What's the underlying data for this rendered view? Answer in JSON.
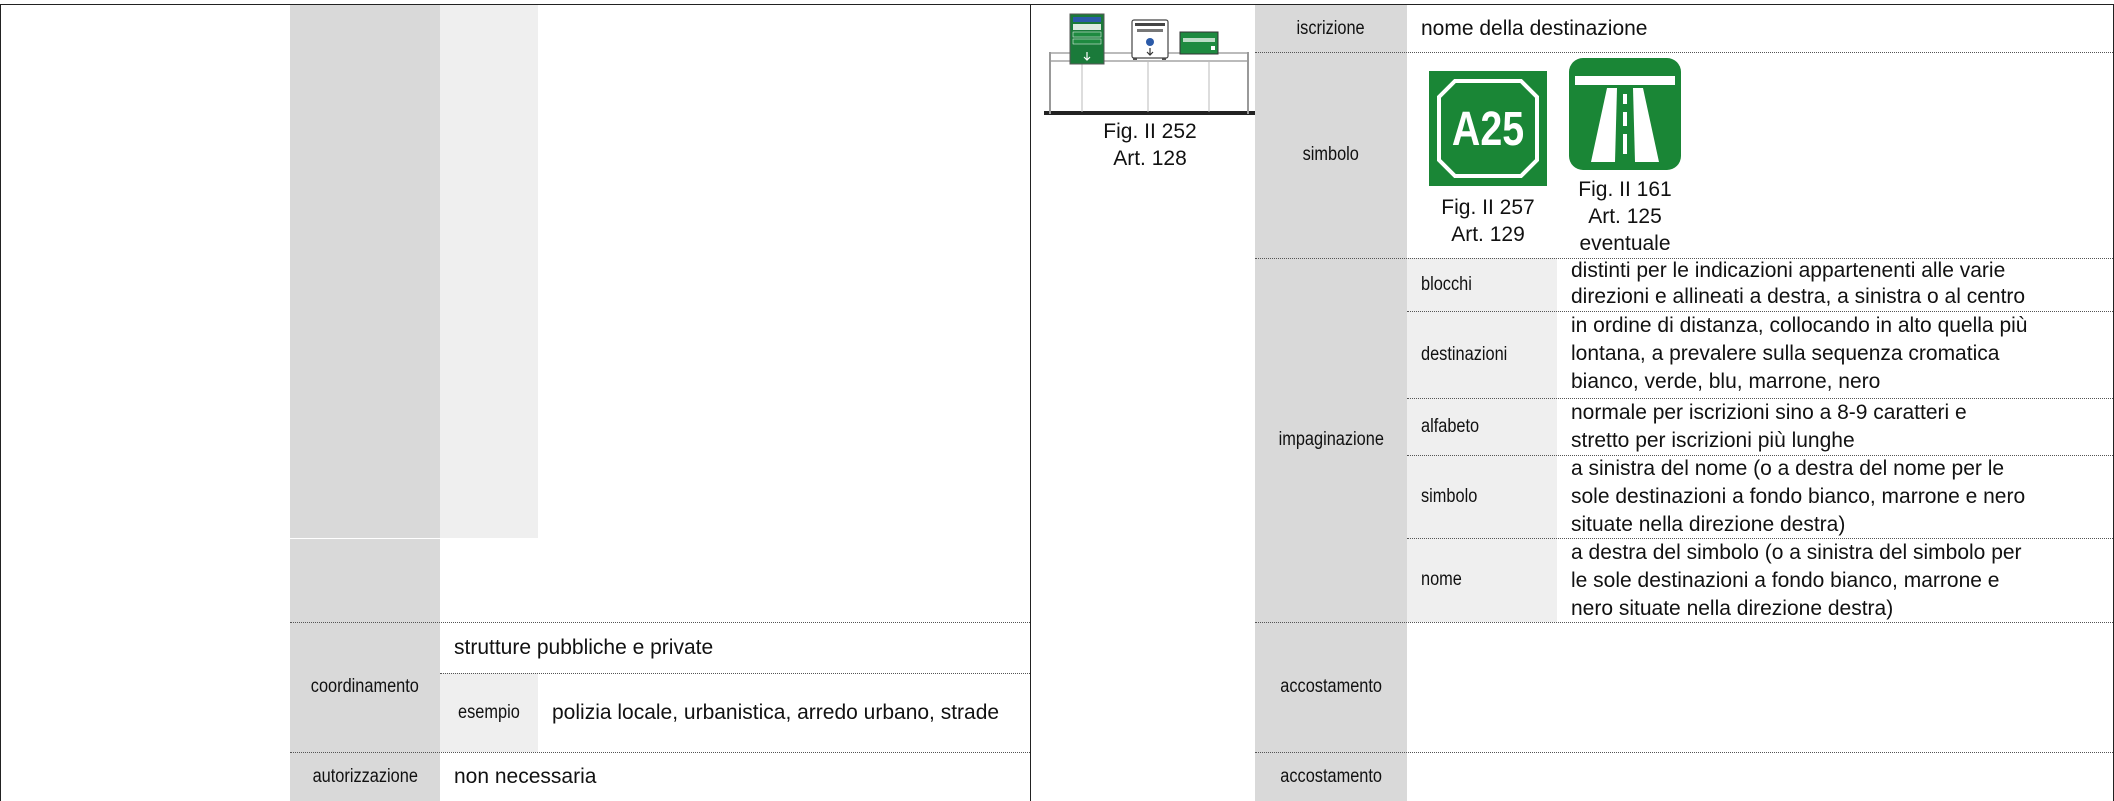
{
  "left": {
    "coordinamento": {
      "label": "coordinamento",
      "value": "strutture pubbliche e private",
      "example_label": "esempio",
      "example_value": "polizia locale, urbanistica, arredo urbano, strade"
    },
    "autorizzazione": {
      "label": "autorizzazione",
      "value": "non necessaria"
    }
  },
  "figure_main": {
    "caption_line1": "Fig. II 252",
    "caption_line2": "Art. 128",
    "sign_left_lines": [
      "BOLOGNA",
      "MILANO",
      "FIRENZE"
    ],
    "sign_mid_lines": [
      "BOLOGNA",
      "centro"
    ],
    "sign_right_text": "FIRENZE"
  },
  "right": {
    "iscrizione": {
      "label": "iscrizione",
      "value": "nome della destinazione"
    },
    "simbolo": {
      "label": "simbolo",
      "shield_text": "A25",
      "fig1_line1": "Fig. II 257",
      "fig1_line2": "Art. 129",
      "fig2_line1": "Fig. II 161",
      "fig2_line2": "Art. 125",
      "fig2_line3": "eventuale"
    },
    "impaginazione": {
      "label": "impaginazione",
      "rows": [
        {
          "label": "blocchi",
          "lines": [
            "distinti per le indicazioni appartenenti alle varie",
            "direzioni e allineati a destra, a sinistra o al centro"
          ]
        },
        {
          "label": "destinazioni",
          "lines": [
            "in ordine di distanza, collocando in alto quella più",
            "lontana, a prevalere sulla sequenza cromatica",
            "bianco, verde, blu, marrone, nero"
          ]
        },
        {
          "label": "alfabeto",
          "lines": [
            "normale per iscrizioni sino a 8-9 caratteri e",
            "stretto per iscrizioni più lunghe"
          ]
        },
        {
          "label": "simbolo",
          "lines": [
            "a sinistra del nome (o a destra del nome per le",
            "sole destinazioni a fondo bianco, marrone e nero",
            "situate nella direzione destra)"
          ]
        },
        {
          "label": "nome",
          "lines": [
            "a destra del simbolo (o a sinistra del simbolo per",
            "le sole destinazioni a fondo bianco, marrone e",
            "nero situate nella direzione destra)"
          ]
        }
      ]
    },
    "accostamento_1": {
      "label": "accostamento"
    },
    "accostamento_2": {
      "label": "accostamento"
    }
  }
}
